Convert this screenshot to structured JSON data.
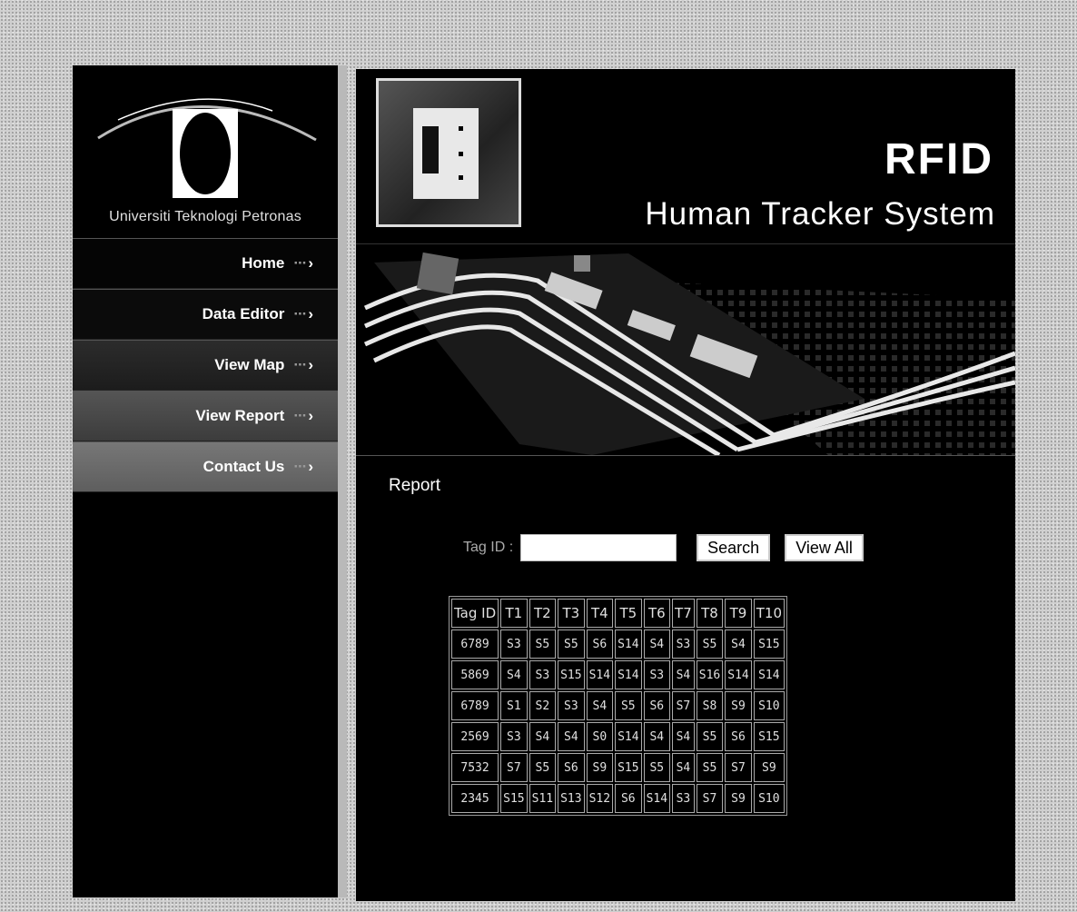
{
  "sidebar": {
    "logo_text": "Universiti Teknologi Petronas",
    "nav": [
      {
        "label": "Home",
        "arrow": "···"
      },
      {
        "label": "Data Editor",
        "arrow": "···"
      },
      {
        "label": "View Map",
        "arrow": "···"
      },
      {
        "label": "View Report",
        "arrow": "···"
      },
      {
        "label": "Contact Us",
        "arrow": "···"
      }
    ]
  },
  "header": {
    "title": "RFID",
    "subtitle": "Human Tracker System"
  },
  "report": {
    "heading": "Report",
    "tag_label": "Tag ID :",
    "tag_value": "",
    "search_label": "Search",
    "view_all_label": "View All",
    "columns": [
      "Tag ID",
      "T1",
      "T2",
      "T3",
      "T4",
      "T5",
      "T6",
      "T7",
      "T8",
      "T9",
      "T10"
    ],
    "rows": [
      [
        "6789",
        "S3",
        "S5",
        "S5",
        "S6",
        "S14",
        "S4",
        "S3",
        "S5",
        "S4",
        "S15"
      ],
      [
        "5869",
        "S4",
        "S3",
        "S15",
        "S14",
        "S14",
        "S3",
        "S4",
        "S16",
        "S14",
        "S14"
      ],
      [
        "6789",
        "S1",
        "S2",
        "S3",
        "S4",
        "S5",
        "S6",
        "S7",
        "S8",
        "S9",
        "S10"
      ],
      [
        "2569",
        "S3",
        "S4",
        "S4",
        "S0",
        "S14",
        "S4",
        "S4",
        "S5",
        "S6",
        "S15"
      ],
      [
        "7532",
        "S7",
        "S5",
        "S6",
        "S9",
        "S15",
        "S5",
        "S4",
        "S5",
        "S7",
        "S9"
      ],
      [
        "2345",
        "S15",
        "S11",
        "S13",
        "S12",
        "S6",
        "S14",
        "S3",
        "S7",
        "S9",
        "S10"
      ]
    ]
  }
}
